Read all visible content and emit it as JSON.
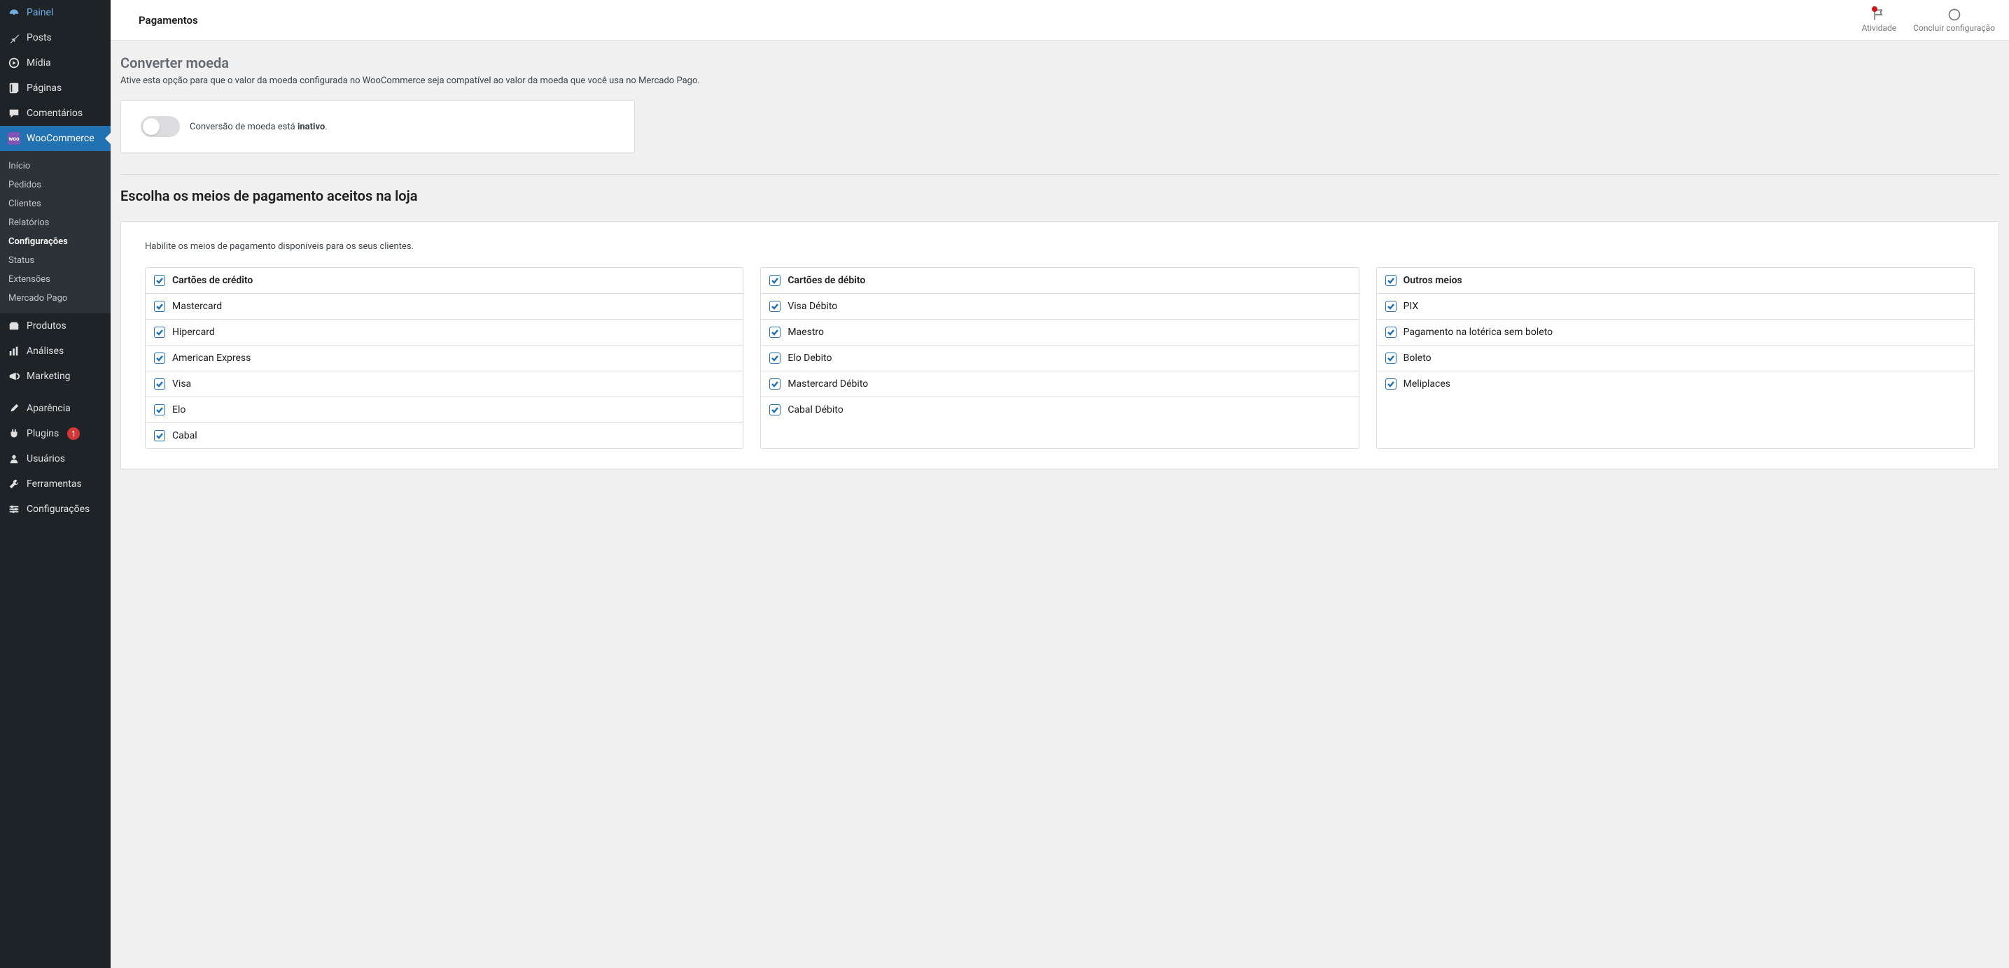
{
  "sidebar": {
    "painel": "Painel",
    "posts": "Posts",
    "midia": "Mídia",
    "paginas": "Páginas",
    "comentarios": "Comentários",
    "woocommerce": "WooCommerce",
    "produtos": "Produtos",
    "analises": "Análises",
    "marketing": "Marketing",
    "aparencia": "Aparência",
    "plugins": "Plugins",
    "plugins_count": "1",
    "usuarios": "Usuários",
    "ferramentas": "Ferramentas",
    "configuracoes": "Configurações",
    "sub": {
      "inicio": "Início",
      "pedidos": "Pedidos",
      "clientes": "Clientes",
      "relatorios": "Relatórios",
      "configuracoes": "Configurações",
      "status": "Status",
      "extensoes": "Extensões",
      "mercadopago": "Mercado Pago"
    }
  },
  "topbar": {
    "title": "Pagamentos",
    "activity": "Atividade",
    "finish": "Concluir configuração"
  },
  "convert": {
    "title": "Converter moeda",
    "desc": "Ative esta opção para que o valor da moeda configurada no WooCommerce seja compatível ao valor da moeda que você usa no Mercado Pago.",
    "label_prefix": "Conversão de moeda está ",
    "label_state": "inativo",
    "label_suffix": "."
  },
  "choose": {
    "title": "Escolha os meios de pagamento aceitos na loja",
    "hint": "Habilite os meios de pagamento disponíveis para os seus clientes.",
    "groups": [
      {
        "header": "Cartões de crédito",
        "items": [
          "Mastercard",
          "Hipercard",
          "American Express",
          "Visa",
          "Elo",
          "Cabal"
        ]
      },
      {
        "header": "Cartões de débito",
        "items": [
          "Visa Débito",
          "Maestro",
          "Elo Debito",
          "Mastercard Débito",
          "Cabal Débito"
        ]
      },
      {
        "header": "Outros meios",
        "items": [
          "PIX",
          "Pagamento na lotérica sem boleto",
          "Boleto",
          "Meliplaces"
        ]
      }
    ]
  }
}
